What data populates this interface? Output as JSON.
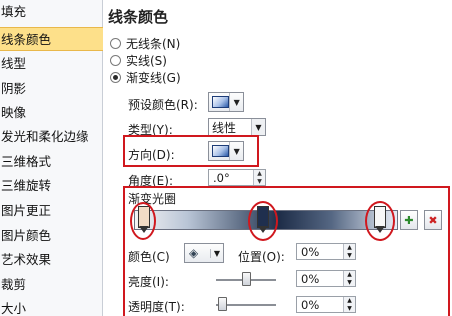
{
  "sidebar": {
    "items": [
      {
        "label": "填充",
        "selected": false
      },
      {
        "label": "线条颜色",
        "selected": true
      },
      {
        "label": "线型",
        "selected": false
      },
      {
        "label": "阴影",
        "selected": false
      },
      {
        "label": "映像",
        "selected": false
      },
      {
        "label": "发光和柔化边缘",
        "selected": false
      },
      {
        "label": "三维格式",
        "selected": false
      },
      {
        "label": "三维旋转",
        "selected": false
      },
      {
        "label": "图片更正",
        "selected": false
      },
      {
        "label": "图片颜色",
        "selected": false
      },
      {
        "label": "艺术效果",
        "selected": false
      },
      {
        "label": "裁剪",
        "selected": false
      },
      {
        "label": "大小",
        "selected": false
      }
    ]
  },
  "main": {
    "title": "线条颜色",
    "radios": [
      {
        "label": "无线条(N)",
        "checked": false
      },
      {
        "label": "实线(S)",
        "checked": false
      },
      {
        "label": "渐变线(G)",
        "checked": true
      }
    ],
    "preset_label": "预设颜色(R):",
    "type_label": "类型(Y):",
    "type_value": "线性",
    "direction_label": "方向(D):",
    "angle_label": "角度(E):",
    "angle_value": ".0°",
    "stops_label": "渐变光圈",
    "color_label": "颜色(C)",
    "position_label": "位置(O):",
    "position_value": "0%",
    "brightness_label": "亮度(I):",
    "brightness_value": "0%",
    "transparency_label": "透明度(T):",
    "transparency_value": "0%",
    "add_stop_icon": "add-stop-icon",
    "remove_stop_icon": "remove-stop-icon"
  },
  "colors": {
    "selected_item": "#fde08a",
    "highlight_red": "#d0181e"
  }
}
